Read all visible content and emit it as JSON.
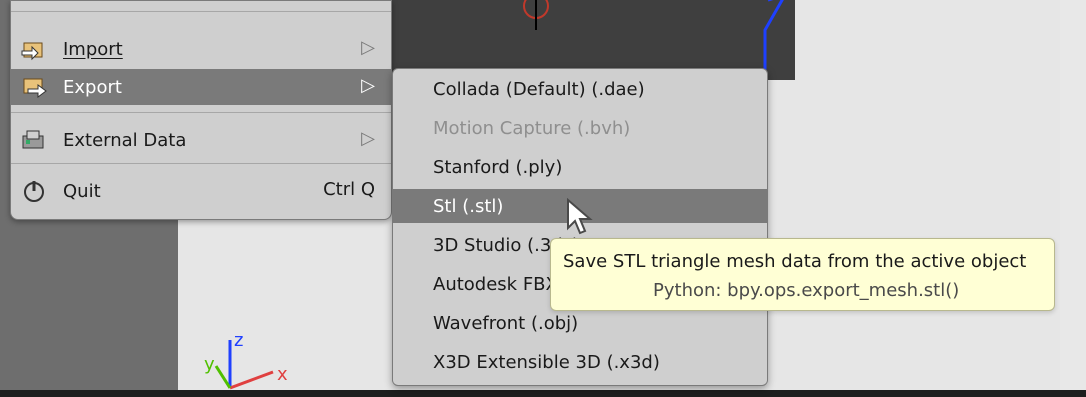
{
  "main_menu": {
    "items": [
      {
        "label": "Import",
        "arrow": "▷",
        "icon": "import-icon"
      },
      {
        "label": "Export",
        "arrow": "▷",
        "icon": "export-icon",
        "selected": true
      },
      {
        "label": "External Data",
        "arrow": "▷",
        "icon": "external-data-icon"
      },
      {
        "label": "Quit",
        "shortcut": "Ctrl Q",
        "icon": "power-icon"
      }
    ]
  },
  "export_menu": {
    "items": [
      {
        "label": "Collada (Default) (.dae)"
      },
      {
        "label": "Motion Capture (.bvh)",
        "disabled": true
      },
      {
        "label": "Stanford (.ply)"
      },
      {
        "label": "Stl (.stl)",
        "selected": true
      },
      {
        "label": "3D Studio (.3ds)"
      },
      {
        "label": "Autodesk FBX (.fbx)"
      },
      {
        "label": "Wavefront (.obj)"
      },
      {
        "label": "X3D Extensible 3D (.x3d)"
      }
    ]
  },
  "tooltip": {
    "title": "Save STL triangle mesh data from the active object",
    "python": "Python: bpy.ops.export_mesh.stl()"
  },
  "axes": {
    "x": "x",
    "y": "y",
    "z": "z"
  },
  "colors": {
    "menu_bg": "#cfcfcf",
    "menu_selected": "#7a7a7a",
    "tooltip_bg": "#ffffd5",
    "axis_x": "#e04040",
    "axis_y": "#50c000",
    "axis_z": "#2040ff"
  }
}
